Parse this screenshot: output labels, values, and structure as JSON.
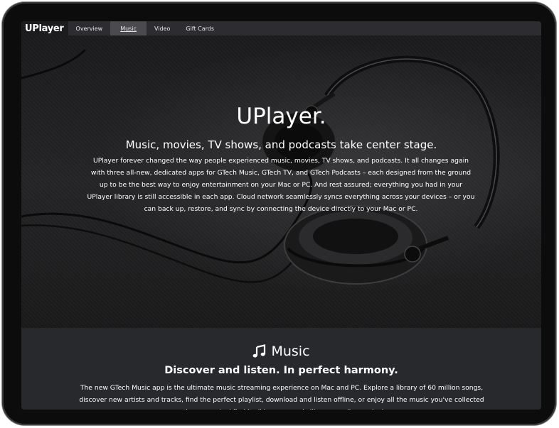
{
  "nav": {
    "logo": "UPlayer",
    "items": [
      {
        "label": "Overview",
        "active": false
      },
      {
        "label": "Music",
        "active": true
      },
      {
        "label": "Video",
        "active": false
      },
      {
        "label": "Gift Cards",
        "active": false
      }
    ]
  },
  "hero": {
    "title": "UPlayer.",
    "subtitle": "Music, movies, TV shows, and podcasts take center stage.",
    "body": "UPlayer forever changed the way people experienced music, movies, TV shows, and podcasts. It all changes again with three all-new, dedicated apps for GTech Music, GTech TV, and GTech Podcasts – each designed from the ground up to be the best way to enjoy entertainment on your Mac or PC. And rest assured; everything you had in your UPlayer library is still accessible in each app. Cloud network seamlessly syncs everything across your devices – or you can back up, restore, and sync by connecting the device directly to your Mac or PC."
  },
  "music": {
    "icon": "music-note-icon",
    "heading": "Music",
    "subheading": "Discover and listen. In perfect harmony.",
    "body": "The new GTech Music app is the ultimate music streaming experience on Mac and PC. Explore a library of 60 million songs, discover new artists and tracks, find the perfect playlist, download and listen offline, or enjoy all the music you've collected over the years. And find it all in your music library on all your devices."
  },
  "colors": {
    "accent": "#4caf50",
    "nav_bg": "#2d2d31",
    "section_bg": "#28292d"
  }
}
